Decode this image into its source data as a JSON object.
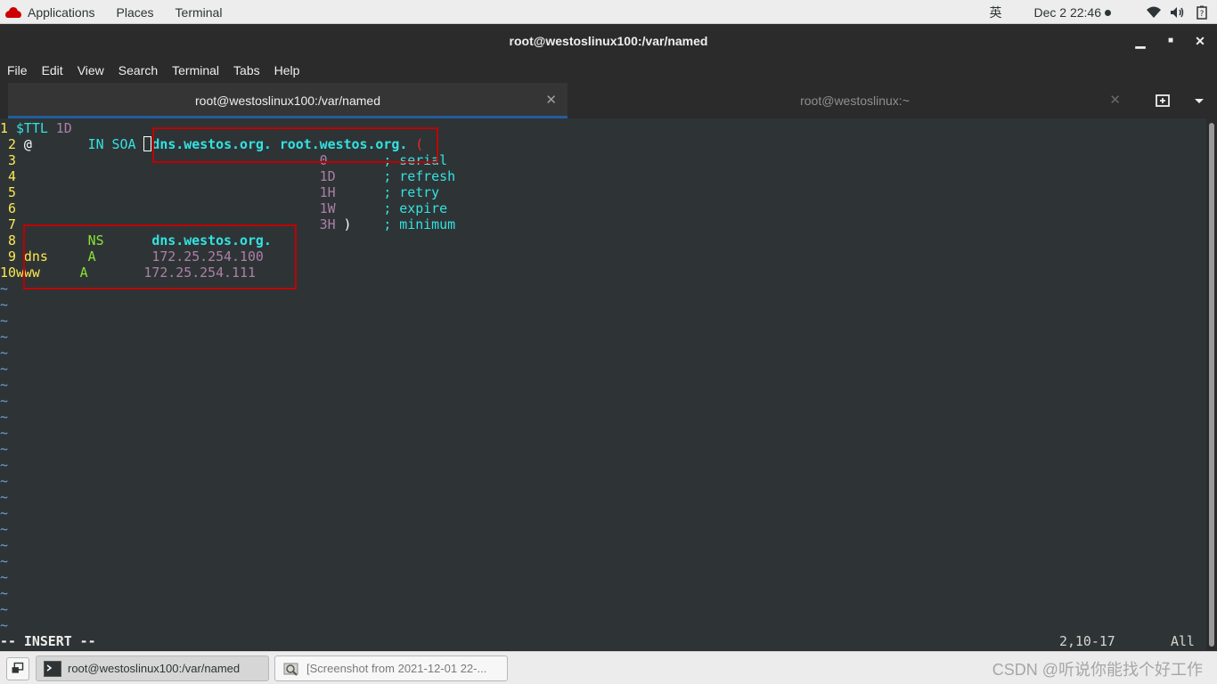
{
  "topbar": {
    "applications": "Applications",
    "places": "Places",
    "terminal": "Terminal",
    "ime": "英",
    "clock": "Dec 2  22:46"
  },
  "window": {
    "title": "root@westoslinux100:/var/named"
  },
  "menu": [
    "File",
    "Edit",
    "View",
    "Search",
    "Terminal",
    "Tabs",
    "Help"
  ],
  "tabs": [
    {
      "label": "root@westoslinux100:/var/named",
      "active": true
    },
    {
      "label": "root@westoslinux:~",
      "active": false
    }
  ],
  "editor": {
    "lines": {
      "l1": {
        "num": "1",
        "a": "$TTL",
        "b": "1D"
      },
      "l2": {
        "num": "2",
        "a": "@",
        "b": "IN SOA",
        "c": "dns.westos.org. root.westos.org.",
        "d": "("
      },
      "l3": {
        "num": "3",
        "val": "0",
        "comment": "; serial"
      },
      "l4": {
        "num": "4",
        "val": "1D",
        "comment": "; refresh"
      },
      "l5": {
        "num": "5",
        "val": "1H",
        "comment": "; retry"
      },
      "l6": {
        "num": "6",
        "val": "1W",
        "comment": "; expire"
      },
      "l7": {
        "num": "7",
        "val": "3H",
        "paren": ")",
        "comment": "; minimum"
      },
      "l8": {
        "num": "8",
        "type": "NS",
        "target": "dns.westos.org."
      },
      "l9": {
        "num": "9",
        "name": "dns",
        "type": "A",
        "target": "172.25.254.100"
      },
      "l10": {
        "num": "10",
        "name": "www",
        "type": "A",
        "target": "172.25.254.111"
      }
    },
    "tilde": "~",
    "mode": "-- INSERT --",
    "position": "2,10-17",
    "scroll": "All"
  },
  "taskbar": {
    "active_task": "root@westoslinux100:/var/named",
    "other_task": "[Screenshot from 2021-12-01 22-...",
    "watermark": "CSDN @听说你能找个好工作"
  },
  "colors": {
    "terminal_bg": "#2e3436",
    "line_number": "#fce94f",
    "annotation_box": "#c00000"
  }
}
